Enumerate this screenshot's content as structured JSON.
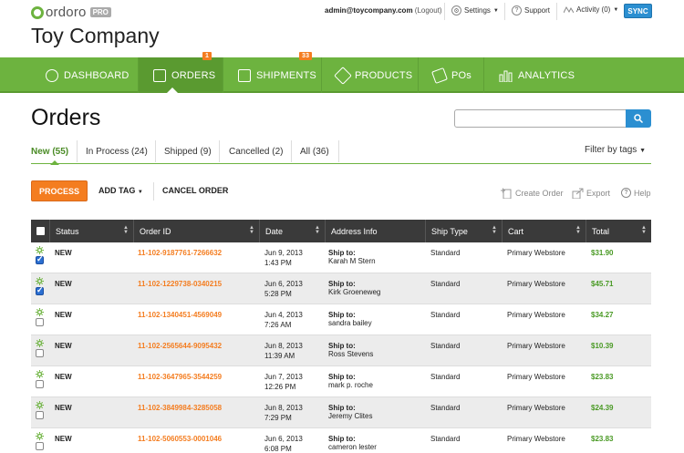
{
  "brand": {
    "name": "ordoro",
    "tier": "PRO",
    "accent": "#6db33f",
    "orange": "#f47d20",
    "blue": "#2b8fd1"
  },
  "topbar": {
    "user_email": "admin@toycompany.com",
    "logout": "(Logout)",
    "settings": "Settings",
    "support": "Support",
    "activity": "Activity (0)",
    "sync": "SYNC"
  },
  "company": "Toy Company",
  "nav": [
    {
      "label": "DASHBOARD",
      "icon": "dashboard-icon"
    },
    {
      "label": "ORDERS",
      "icon": "orders-icon",
      "badge": "1"
    },
    {
      "label": "SHIPMENTS",
      "icon": "box-icon",
      "badge": "33"
    },
    {
      "label": "PRODUCTS",
      "icon": "tag-icon"
    },
    {
      "label": "POs",
      "icon": "ticket-icon"
    },
    {
      "label": "ANALYTICS",
      "icon": "bar-chart-icon"
    }
  ],
  "page_title": "Orders",
  "search": {
    "value": ""
  },
  "tabs": [
    {
      "label": "New (55)"
    },
    {
      "label": "In Process (24)"
    },
    {
      "label": "Shipped (9)"
    },
    {
      "label": "Cancelled (2)"
    },
    {
      "label": "All (36)"
    }
  ],
  "filter": "Filter by tags",
  "actions": {
    "process": "PROCESS",
    "add_tag": "ADD TAG",
    "cancel": "CANCEL ORDER",
    "create": "Create Order",
    "export": "Export",
    "help": "Help"
  },
  "columns": [
    "Status",
    "Order ID",
    "Date",
    "Address Info",
    "Ship Type",
    "Cart",
    "Total"
  ],
  "rows": [
    {
      "checked": true,
      "status": "NEW",
      "order_id": "11-102-9187761-7266632",
      "date": "Jun 9, 2013",
      "time": "1:43 PM",
      "ship_label": "Ship to:",
      "ship_name": "Karah M Stern",
      "ship_type": "Standard",
      "cart": "Primary Webstore",
      "total": "$31.90"
    },
    {
      "checked": true,
      "status": "NEW",
      "order_id": "11-102-1229738-0340215",
      "date": "Jun 6, 2013",
      "time": "5:28 PM",
      "ship_label": "Ship to:",
      "ship_name": "Kirk Groeneweg",
      "ship_type": "Standard",
      "cart": "Primary Webstore",
      "total": "$45.71"
    },
    {
      "checked": false,
      "status": "NEW",
      "order_id": "11-102-1340451-4569049",
      "date": "Jun 4, 2013",
      "time": "7:26 AM",
      "ship_label": "Ship to:",
      "ship_name": "sandra bailey",
      "ship_type": "Standard",
      "cart": "Primary Webstore",
      "total": "$34.27"
    },
    {
      "checked": false,
      "status": "NEW",
      "order_id": "11-102-2565644-9095432",
      "date": "Jun 8, 2013",
      "time": "11:39 AM",
      "ship_label": "Ship to:",
      "ship_name": "Ross Stevens",
      "ship_type": "Standard",
      "cart": "Primary Webstore",
      "total": "$10.39"
    },
    {
      "checked": false,
      "status": "NEW",
      "order_id": "11-102-3647965-3544259",
      "date": "Jun 7, 2013",
      "time": "12:26 PM",
      "ship_label": "Ship to:",
      "ship_name": "mark p. roche",
      "ship_type": "Standard",
      "cart": "Primary Webstore",
      "total": "$23.83"
    },
    {
      "checked": false,
      "status": "NEW",
      "order_id": "11-102-3849984-3285058",
      "date": "Jun 8, 2013",
      "time": "7:29 PM",
      "ship_label": "Ship to:",
      "ship_name": "Jeremy Clites",
      "ship_type": "Standard",
      "cart": "Primary Webstore",
      "total": "$24.39"
    },
    {
      "checked": false,
      "status": "NEW",
      "order_id": "11-102-5060553-0001046",
      "date": "Jun 6, 2013",
      "time": "6:08 PM",
      "ship_label": "Ship to:",
      "ship_name": "cameron lester",
      "ship_type": "Standard",
      "cart": "Primary Webstore",
      "total": "$23.83"
    }
  ]
}
